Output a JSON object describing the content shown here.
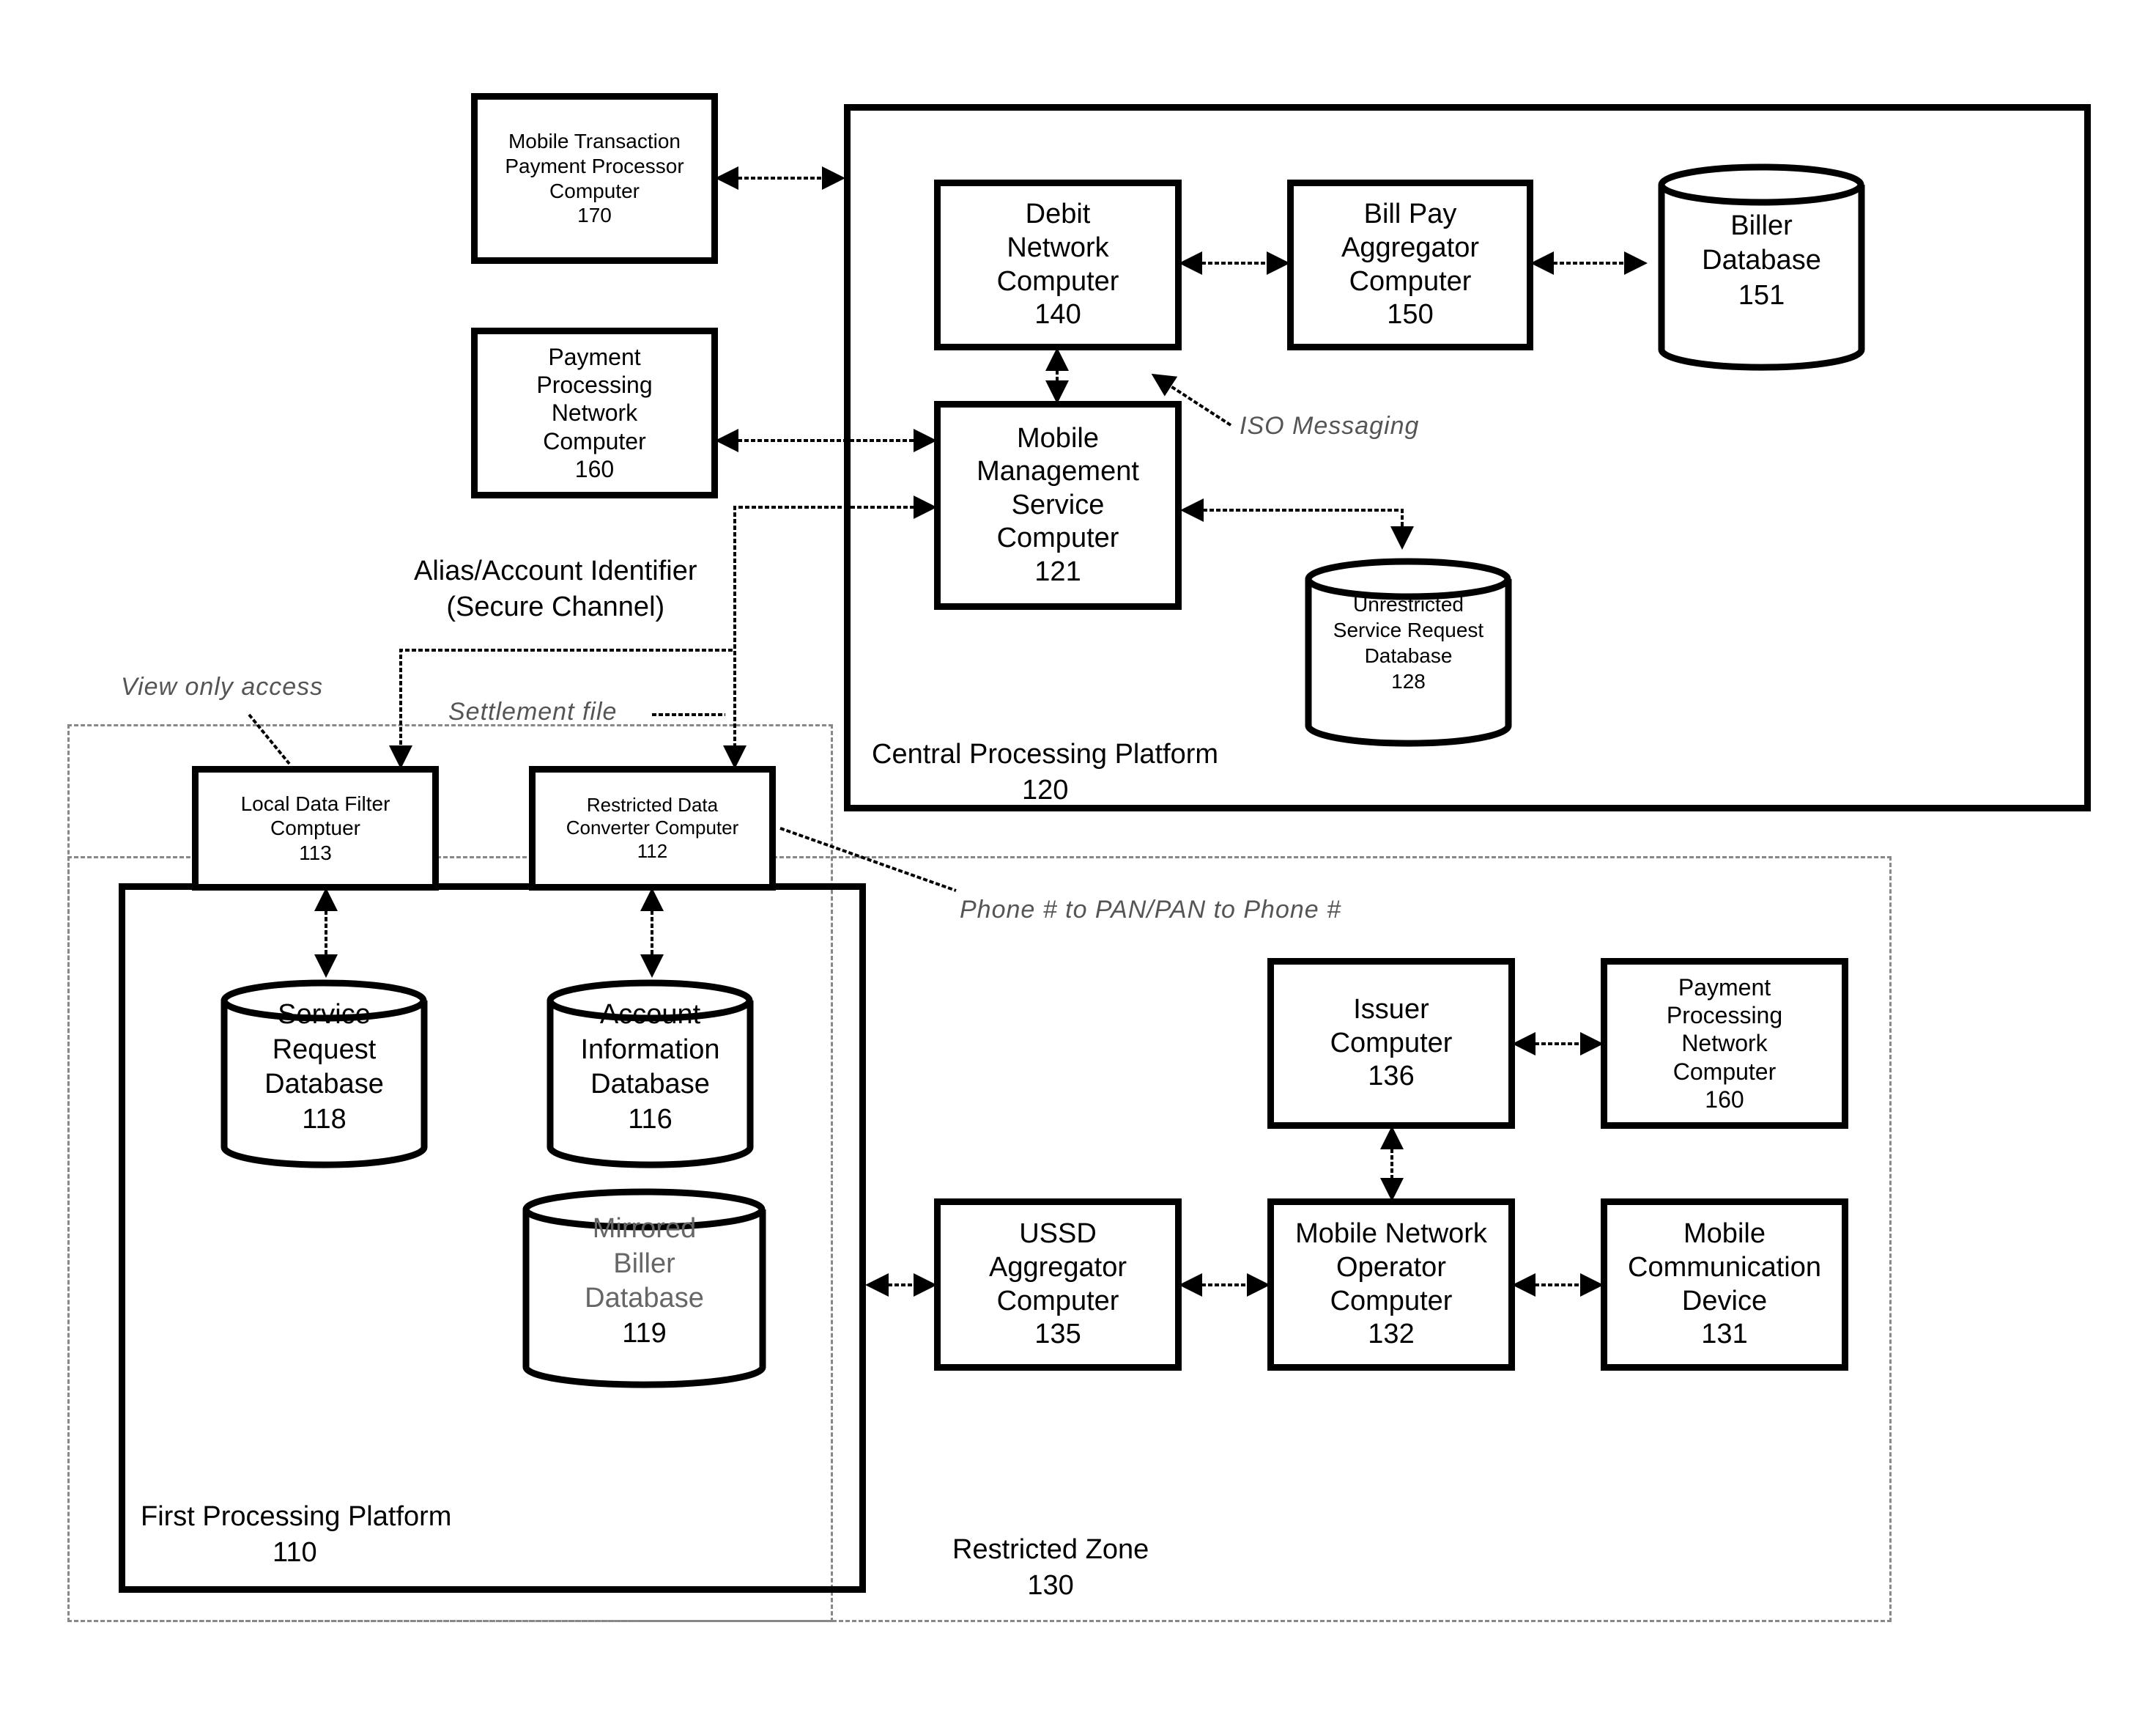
{
  "nodes": {
    "mtpp": {
      "name": "Mobile Transaction Payment Processor Computer",
      "lines": [
        "Mobile Transaction",
        "Payment Processor",
        "Computer",
        "170"
      ]
    },
    "ppn_top": {
      "lines": [
        "Payment",
        "Processing",
        "Network",
        "Computer",
        "160"
      ]
    },
    "debit": {
      "lines": [
        "Debit",
        "Network",
        "Computer",
        "140"
      ]
    },
    "billpay": {
      "lines": [
        "Bill Pay",
        "Aggregator",
        "Computer",
        "150"
      ]
    },
    "biller_db": {
      "lines": [
        "Biller",
        "Database",
        "151"
      ]
    },
    "mms": {
      "lines": [
        "Mobile",
        "Management",
        "Service",
        "Computer",
        "121"
      ]
    },
    "unrestricted_db": {
      "lines": [
        "Unrestricted",
        "Service Request",
        "Database",
        "128"
      ]
    },
    "ldf": {
      "lines": [
        "Local Data Filter",
        "Comptuer",
        "113"
      ]
    },
    "rdc": {
      "lines": [
        "Restricted Data",
        "Converter Computer",
        "112"
      ]
    },
    "srdb": {
      "lines": [
        "Service",
        "Request",
        "Database",
        "118"
      ]
    },
    "aidb": {
      "lines": [
        "Account",
        "Information",
        "Database",
        "116"
      ]
    },
    "mbdb": {
      "lines": [
        "Mirrored",
        "Biller",
        "Database",
        "119"
      ]
    },
    "issuer": {
      "lines": [
        "Issuer",
        "Computer",
        "136"
      ]
    },
    "ppn_bottom": {
      "lines": [
        "Payment",
        "Processing",
        "Network",
        "Computer",
        "160"
      ]
    },
    "ussd": {
      "lines": [
        "USSD",
        "Aggregator",
        "Computer",
        "135"
      ]
    },
    "mno": {
      "lines": [
        "Mobile Network",
        "Operator",
        "Computer",
        "132"
      ]
    },
    "mcd": {
      "lines": [
        "Mobile",
        "Communication",
        "Device",
        "131"
      ]
    }
  },
  "platforms": {
    "central": {
      "lines": [
        "Central Processing Platform",
        "120"
      ]
    },
    "first": {
      "lines": [
        "First Processing Platform",
        "110"
      ]
    },
    "restricted": {
      "lines": [
        "Restricted Zone",
        "130"
      ]
    }
  },
  "annotations": {
    "iso": "ISO Messaging",
    "alias": [
      "Alias/Account Identifier",
      "(Secure Channel)"
    ],
    "view_only": "View only access",
    "settlement": "Settlement file",
    "phone_pan": "Phone # to PAN/PAN to Phone #"
  }
}
